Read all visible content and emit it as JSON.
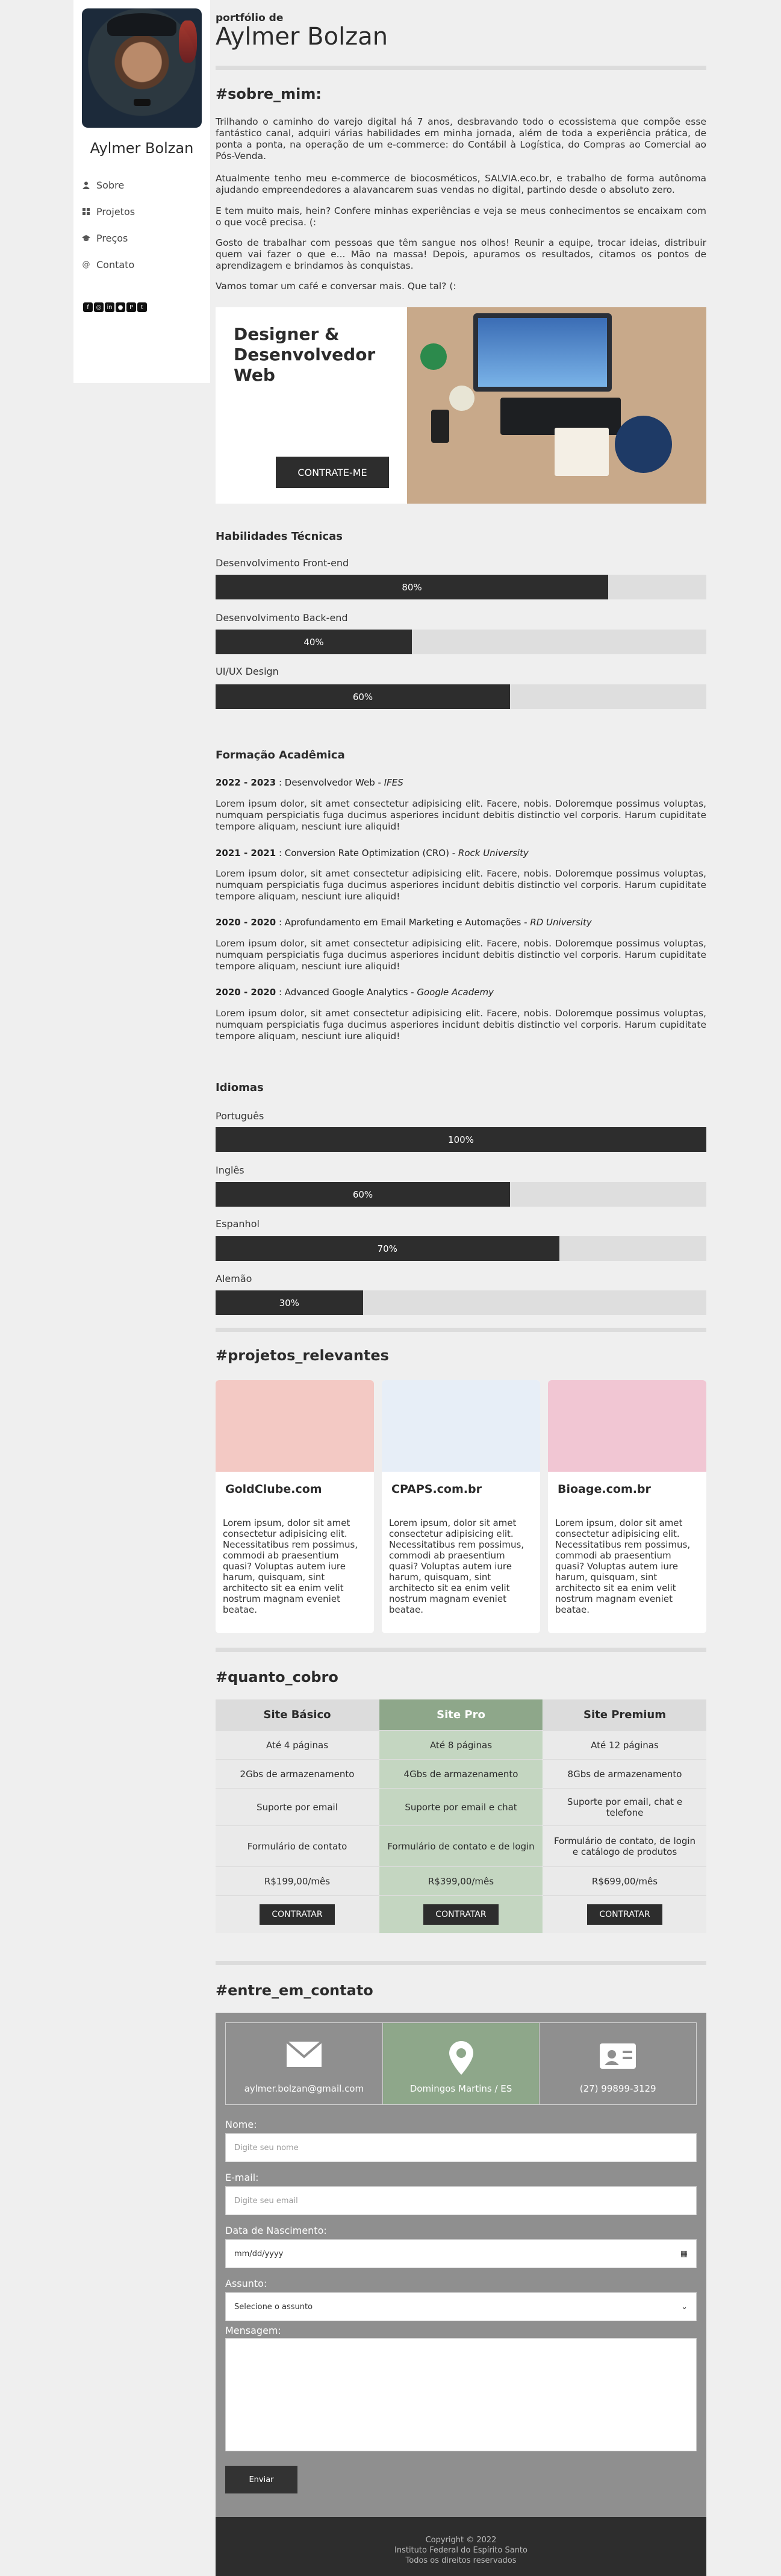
{
  "sidebar": {
    "name": "Aylmer Bolzan",
    "nav": [
      {
        "label": "Sobre",
        "icon": "user-icon"
      },
      {
        "label": "Projetos",
        "icon": "grid-icon"
      },
      {
        "label": "Preços",
        "icon": "graduation-cap-icon"
      },
      {
        "label": "Contato",
        "icon": "at-icon"
      }
    ],
    "social": [
      "facebook-icon",
      "instagram-icon",
      "linkedin-icon",
      "github-icon",
      "pinterest-icon",
      "twitter-icon"
    ]
  },
  "header": {
    "eyebrow": "portfólio de",
    "title": "Aylmer Bolzan"
  },
  "about": {
    "heading": "#sobre_mim:",
    "paragraphs": [
      "Trilhando o caminho do varejo digital há 7 anos, desbravando todo o ecossistema que compõe esse fantástico canal, adquiri várias habilidades em minha jornada, além de toda a experiência prática, de ponta a ponta, na operação de um e-commerce: do Contábil à Logística, do Compras ao Comercial ao Pós-Venda.",
      "Atualmente tenho meu e-commerce de biocosméticos, SALVIA.eco.br, e trabalho de forma autônoma ajudando empreendedores a alavancarem suas vendas no digital, partindo desde o absoluto zero.",
      "E tem muito mais, hein? Confere minhas experiências e veja se meus conhecimentos se encaixam com o que você precisa. (:",
      "Gosto de trabalhar com pessoas que têm sangue nos olhos! Reunir a equipe, trocar ideias, distribuir quem vai fazer o que e... Mão na massa! Depois, apuramos os resultados, citamos os pontos de aprendizagem e brindamos às conquistas.",
      "Vamos tomar um café e conversar mais. Que tal? (:"
    ]
  },
  "hero": {
    "title": "Designer & Desenvolvedor Web",
    "button": "CONTRATE-ME"
  },
  "skills": {
    "heading": "Habilidades Técnicas",
    "items": [
      {
        "label": "Desenvolvimento Front-end",
        "percent": 80,
        "text": "80%"
      },
      {
        "label": "Desenvolvimento Back-end",
        "percent": 40,
        "text": "40%"
      },
      {
        "label": "UI/UX Design",
        "percent": 60,
        "text": "60%"
      }
    ]
  },
  "education": {
    "heading": "Formação Acadêmica",
    "lorem": "Lorem ipsum dolor, sit amet consectetur adipisicing elit. Facere, nobis. Doloremque possimus voluptas, numquam perspiciatis fuga ducimus asperiores incidunt debitis distinctio vel corporis. Harum cupiditate tempore aliquam, nesciunt iure aliquid!",
    "items": [
      {
        "years": "2022 - 2023",
        "course": "Desenvolvedor Web",
        "school": "IFES"
      },
      {
        "years": "2021 - 2021",
        "course": "Conversion Rate Optimization (CRO)",
        "school": "Rock University"
      },
      {
        "years": "2020 - 2020",
        "course": "Aprofundamento em Email Marketing e Automações",
        "school": "RD University"
      },
      {
        "years": "2020 - 2020",
        "course": "Advanced Google Analytics",
        "school": "Google Academy"
      }
    ]
  },
  "languages": {
    "heading": "Idiomas",
    "items": [
      {
        "label": "Português",
        "percent": 100,
        "text": "100%"
      },
      {
        "label": "Inglês",
        "percent": 60,
        "text": "60%"
      },
      {
        "label": "Espanhol",
        "percent": 70,
        "text": "70%"
      },
      {
        "label": "Alemão",
        "percent": 30,
        "text": "30%"
      }
    ]
  },
  "projects": {
    "heading": "#projetos_relevantes",
    "desc": "Lorem ipsum, dolor sit amet consectetur adipisicing elit. Necessitatibus rem possimus, commodi ab praesentium quasi? Voluptas autem iure harum, quisquam, sint architecto sit ea enim velit nostrum magnam eveniet beatae.",
    "items": [
      {
        "name": "GoldClube.com",
        "thumb_color": "#f3c9c4"
      },
      {
        "name": "CPAPS.com.br",
        "thumb_color": "#e7eef7"
      },
      {
        "name": "Bioage.com.br",
        "thumb_color": "#f1c6d3"
      }
    ]
  },
  "pricing": {
    "heading": "#quanto_cobro",
    "plans": [
      {
        "name": "Site Básico",
        "pages": "Até 4 páginas",
        "storage": "2Gbs de armazenamento",
        "support": "Suporte por email",
        "form": "Formulário de contato",
        "price": "R$199,00/mês",
        "button": "CONTRATAR"
      },
      {
        "name": "Site Pro",
        "pages": "Até 8 páginas",
        "storage": "4Gbs de armazenamento",
        "support": "Suporte por email e chat",
        "form": "Formulário de contato e de login",
        "price": "R$399,00/mês",
        "button": "CONTRATAR"
      },
      {
        "name": "Site Premium",
        "pages": "Até 12 páginas",
        "storage": "8Gbs de armazenamento",
        "support": "Suporte por email, chat e telefone",
        "form": "Formulário de contato, de login e catálogo de produtos",
        "price": "R$699,00/mês",
        "button": "CONTRATAR"
      }
    ],
    "highlight_color": "#c4d6c1",
    "highlight_head_color": "#8ea78a"
  },
  "contact": {
    "heading": "#entre_em_contato",
    "cards": [
      {
        "icon": "envelope-icon",
        "text": "aylmer.bolzan@gmail.com"
      },
      {
        "icon": "location-pin-icon",
        "text": "Domingos Martins / ES"
      },
      {
        "icon": "contact-card-icon",
        "text": "(27) 99899-3129"
      }
    ],
    "fields": {
      "name_label": "Nome:",
      "name_placeholder": "Digite seu nome",
      "email_label": "E-mail:",
      "email_placeholder": "Digite seu email",
      "birth_label": "Data de Nascimento:",
      "birth_placeholder": "mm/dd/yyyy",
      "subject_label": "Assunto:",
      "subject_value": "Selecione o assunto",
      "message_label": "Mensagem:"
    },
    "send": "Enviar"
  },
  "footer": {
    "line1": "Copyright © 2022",
    "line2": "Instituto Federal do Espírito Santo",
    "line3": "Todos os direitos reservados"
  }
}
